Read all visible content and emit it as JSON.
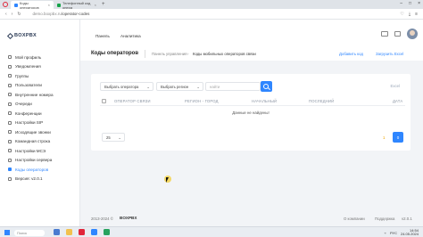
{
  "browser": {
    "tabs": [
      {
        "title": "Коды операторов",
        "active": true
      },
      {
        "title": "Телефонный код опера",
        "active": false
      }
    ],
    "url_host": "demo.boxpbx.ru",
    "url_path": "/operator-codes"
  },
  "app": {
    "logo": "BOXPBX",
    "topnav": {
      "panel": "Панель",
      "analytics": "Аналитика"
    },
    "sidebar": {
      "items": [
        {
          "label": "Мой профиль"
        },
        {
          "label": "Уведомления"
        },
        {
          "label": "Группы"
        },
        {
          "label": "Пользователи"
        },
        {
          "label": "Внутренние номера"
        },
        {
          "label": "Очереди"
        },
        {
          "label": "Конференции"
        },
        {
          "label": "Настройки SIP"
        },
        {
          "label": "Исходящие звонки"
        },
        {
          "label": "Командная строка"
        },
        {
          "label": "Настройки МСЭ"
        },
        {
          "label": "Настройки сервера"
        },
        {
          "label": "Коды операторов",
          "active": true
        },
        {
          "label": "Версия: v2.0.1"
        }
      ]
    }
  },
  "page": {
    "title": "Коды операторов",
    "breadcrumb": [
      "Панель управления",
      "Коды мобильных операторов связи"
    ],
    "add_code": "Добавить код",
    "upload_excel": "Загрузить Excel"
  },
  "filters": {
    "operator": "Выбрать оператора",
    "region": "Выбрать регион",
    "search_placeholder": "найти",
    "excel": "Excel"
  },
  "table": {
    "headers": [
      "ОПЕРАТОР СВЯЗИ",
      "РЕГИОН - ГОРОД",
      "НАЧАЛЬНЫЙ",
      "ПОСЛЕДНИЙ",
      "ДАТА"
    ],
    "empty_text": "Данные не найдены!"
  },
  "pagination": {
    "per_page": "25",
    "page_label": "1",
    "current_page": "0"
  },
  "footer": {
    "copyright": "2013-2024 ©",
    "brand": "BOXPBX",
    "about": "О компании",
    "support": "Поддержка",
    "version": "v2.0.1"
  },
  "taskbar": {
    "search": "Поиск",
    "time": "14:54",
    "date": "24.05.2024",
    "lang": "РУС"
  },
  "colors": {
    "accent": "#2f86ff",
    "pager_amber": "#f0a500"
  }
}
